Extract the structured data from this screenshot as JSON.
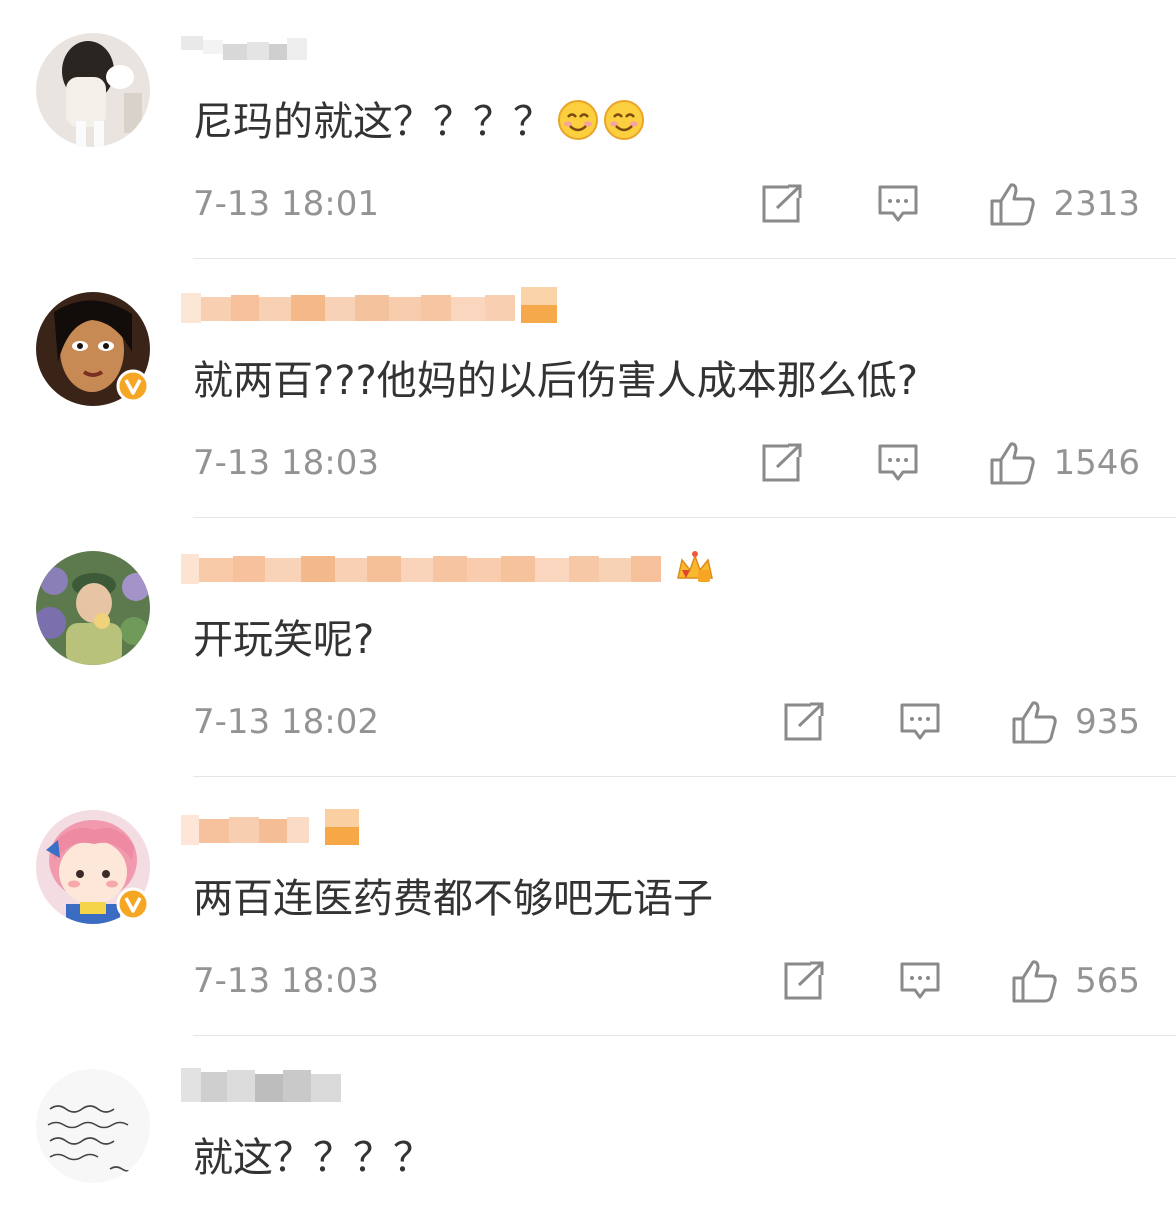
{
  "comments": [
    {
      "text": "尼玛的就这？？？？",
      "emoji": [
        "smile-emoji",
        "smile-emoji"
      ],
      "time": "7-13 18:01",
      "likes": "2313",
      "verified": false,
      "username_badge": null
    },
    {
      "text": "就两百???他妈的以后伤害人成本那么低?",
      "emoji": [],
      "time": "7-13 18:03",
      "likes": "1546",
      "verified": true,
      "username_badge": null
    },
    {
      "text": "开玩笑呢?",
      "emoji": [],
      "time": "7-13 18:02",
      "likes": "935",
      "verified": false,
      "username_badge": "crown-badge-icon"
    },
    {
      "text": "两百连医药费都不够吧无语子",
      "emoji": [],
      "time": "7-13 18:03",
      "likes": "565",
      "verified": true,
      "username_badge": null
    },
    {
      "text": "就这？？？？",
      "emoji": [],
      "time": "",
      "likes": "",
      "verified": false,
      "username_badge": null
    }
  ],
  "icons": {
    "share": "share-icon",
    "reply": "reply-icon",
    "like": "thumbs-up-icon",
    "verified": "verified-badge-icon"
  },
  "colors": {
    "text": "#333333",
    "meta": "#939393",
    "icon": "#8a8a8a",
    "divider": "#e6e6e6",
    "verified": "#f5a623",
    "username_blur": "#f6b073"
  }
}
